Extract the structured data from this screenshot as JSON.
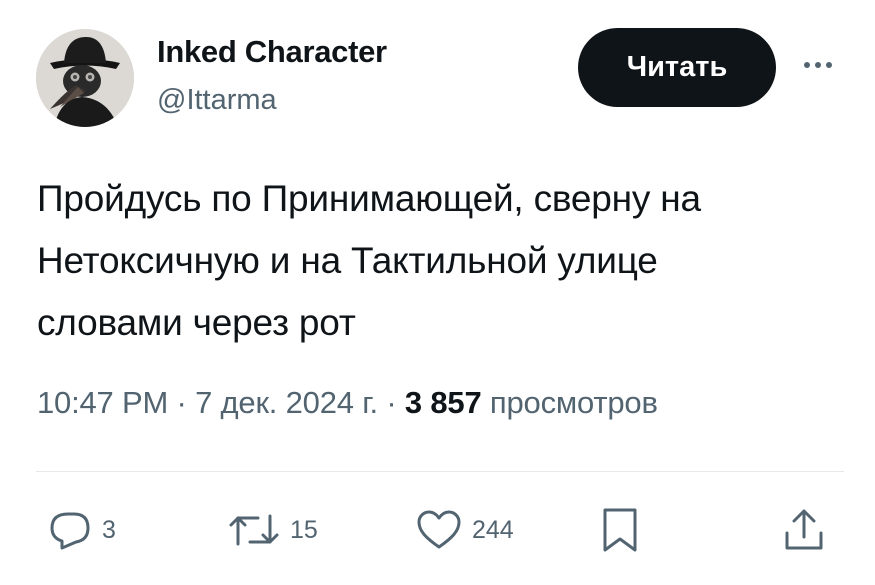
{
  "author": {
    "name": "Inked Character",
    "handle": "@Ittarma"
  },
  "follow_button": "Читать",
  "more_icon": "ellipsis-icon",
  "text_lines": [
    "Пройдусь по Принимающей, сверну на",
    "Нетоксичную и на Тактильной улице",
    "словами через рот"
  ],
  "meta": {
    "time": "10:47 PM",
    "separator": "·",
    "date": "7 дек. 2024 г.",
    "views_count": "3 857",
    "views_label": "просмотров"
  },
  "actions": {
    "replies": "3",
    "retweets": "15",
    "likes": "244"
  },
  "colors": {
    "text": "#0f1419",
    "secondary": "#536471",
    "button": "#0f1419",
    "divider": "#e6e9eb"
  }
}
